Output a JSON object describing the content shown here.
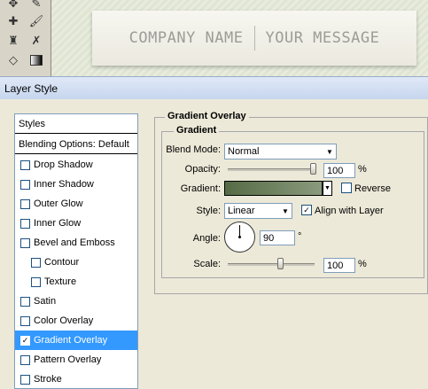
{
  "banner": {
    "company": "COMPANY NAME",
    "message": "YOUR MESSAGE"
  },
  "dialog": {
    "title": "Layer Style"
  },
  "styles_list": {
    "header": "Styles",
    "blending": "Blending Options: Default",
    "items": [
      {
        "label": "Drop Shadow",
        "checked": false
      },
      {
        "label": "Inner Shadow",
        "checked": false
      },
      {
        "label": "Outer Glow",
        "checked": false
      },
      {
        "label": "Inner Glow",
        "checked": false
      },
      {
        "label": "Bevel and Emboss",
        "checked": false
      },
      {
        "label": "Contour",
        "checked": false
      },
      {
        "label": "Texture",
        "checked": false
      },
      {
        "label": "Satin",
        "checked": false
      },
      {
        "label": "Color Overlay",
        "checked": false
      },
      {
        "label": "Gradient Overlay",
        "checked": true
      },
      {
        "label": "Pattern Overlay",
        "checked": false
      },
      {
        "label": "Stroke",
        "checked": false
      }
    ]
  },
  "panel": {
    "title": "Gradient Overlay",
    "group_title": "Gradient",
    "blend_mode_label": "Blend Mode:",
    "blend_mode_value": "Normal",
    "opacity_label": "Opacity:",
    "opacity_value": "100",
    "opacity_unit": "%",
    "gradient_label": "Gradient:",
    "reverse_label": "Reverse",
    "style_label": "Style:",
    "style_value": "Linear",
    "align_label": "Align with Layer",
    "angle_label": "Angle:",
    "angle_value": "90",
    "angle_unit": "°",
    "scale_label": "Scale:",
    "scale_value": "100",
    "scale_unit": "%"
  },
  "colors": {
    "gradient_start": "#556b45",
    "gradient_end": "#8a9a7c",
    "selection": "#3399ff"
  },
  "checks": {
    "reverse": false,
    "align": true
  }
}
